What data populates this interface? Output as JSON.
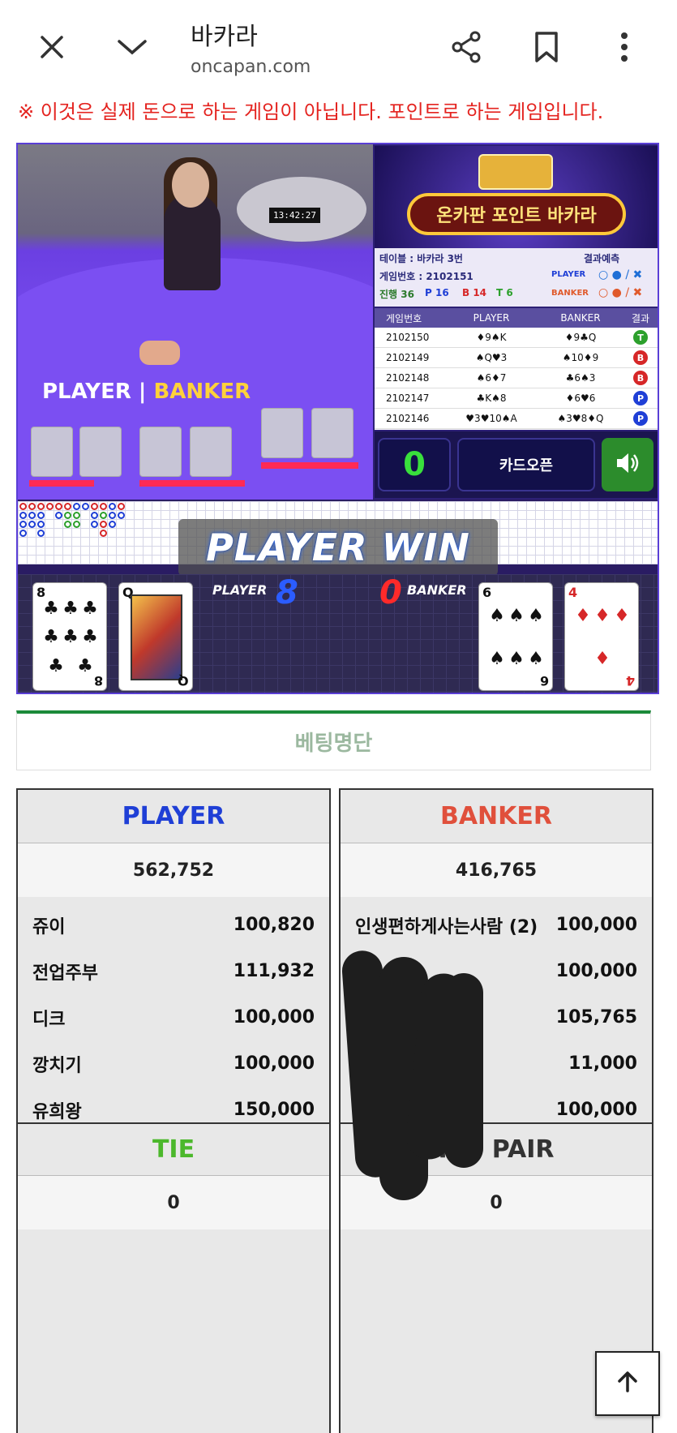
{
  "browser": {
    "title": "바카라",
    "url": "oncapan.com"
  },
  "notice": "※ 이것은 실제 돈으로 하는 게임이 아닙니다. 포인트로 하는 게임입니다.",
  "game": {
    "video": {
      "clock": "13:42:27",
      "player_label": "PLAYER",
      "banker_label": "BANKER"
    },
    "banner_title": "온카판 포인트 바카라",
    "info": {
      "table": "테이블 : 바카라 3번",
      "predict": "결과예측",
      "game_no": "게임번호 : 2102151",
      "progress_label": "진행 36",
      "p_count": "P 16",
      "b_count": "B 14",
      "t_count": "T 6",
      "player": "PLAYER",
      "banker": "BANKER"
    },
    "history": {
      "headers": [
        "게임번호",
        "PLAYER",
        "BANKER",
        "결과"
      ],
      "rows": [
        {
          "no": "2102150",
          "player": "♦9♠K",
          "banker": "♦9♣Q",
          "result": "T",
          "color": "#2ca02c"
        },
        {
          "no": "2102149",
          "player": "♠Q♥3",
          "banker": "♠10♦9",
          "result": "B",
          "color": "#d62728"
        },
        {
          "no": "2102148",
          "player": "♠6♦7",
          "banker": "♣6♠3",
          "result": "B",
          "color": "#d62728"
        },
        {
          "no": "2102147",
          "player": "♣K♠8",
          "banker": "♦6♥6",
          "result": "P",
          "color": "#1f3fd6"
        },
        {
          "no": "2102146",
          "player": "♥3♥10♠A",
          "banker": "♠3♥8♦Q",
          "result": "P",
          "color": "#1f3fd6"
        }
      ]
    },
    "count": "0",
    "open_label": "카드오픈",
    "win_text": "PLAYER WIN",
    "player_score_label": "PLAYER",
    "player_score": "8",
    "banker_score_label": "BANKER",
    "banker_score": "0",
    "player_cards": [
      {
        "rank": "8",
        "suit": "♣",
        "color": "#111"
      },
      {
        "rank": "Q",
        "suit": "♣",
        "color": "#111"
      }
    ],
    "banker_cards": [
      {
        "rank": "6",
        "suit": "♠",
        "color": "#111"
      },
      {
        "rank": "4",
        "suit": "♦",
        "color": "#d62728"
      }
    ]
  },
  "bet_list": {
    "title": "베팅명단",
    "player": {
      "header": "PLAYER",
      "color": "#1f3fd6",
      "total": "562,752",
      "entries": [
        {
          "name": "쥬이",
          "amount": "100,820"
        },
        {
          "name": "전업주부",
          "amount": "111,932"
        },
        {
          "name": "디크",
          "amount": "100,000"
        },
        {
          "name": "깡치기",
          "amount": "100,000"
        },
        {
          "name": "유희왕",
          "amount": "150,000"
        }
      ]
    },
    "banker": {
      "header": "BANKER",
      "color": "#e0503c",
      "total": "416,765",
      "entries": [
        {
          "name": "인생편하게사는사람 (2)",
          "amount": "100,000"
        },
        {
          "name": "",
          "amount": "100,000"
        },
        {
          "name": "",
          "amount": "105,765"
        },
        {
          "name": "",
          "amount": "11,000"
        },
        {
          "name": "",
          "amount": "100,000"
        }
      ]
    },
    "tie": {
      "header": "TIE",
      "color": "#4cb82c",
      "total": "0"
    },
    "pair": {
      "header": "P/B PAIR",
      "color": "#333",
      "total": "0"
    }
  }
}
